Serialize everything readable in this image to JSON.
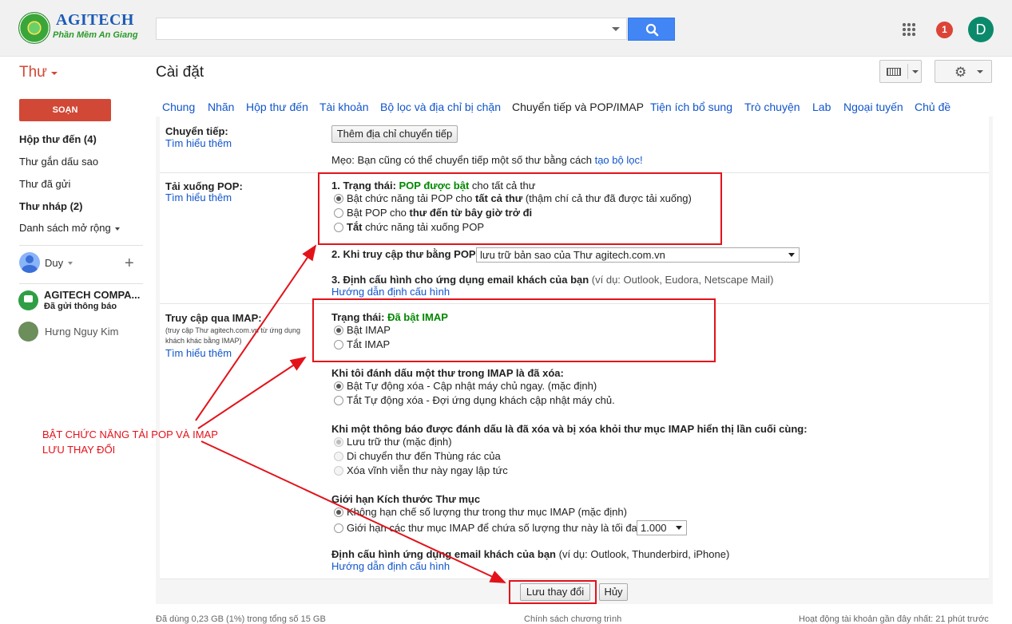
{
  "header": {
    "logo_title": "AGITECH",
    "logo_subtitle": "Phần Mềm An Giang",
    "search_value": "",
    "notification_count": "1",
    "account_initial": "D",
    "icons": [
      "search-icon",
      "apps-grid-icon",
      "gear-icon",
      "keyboard-icon"
    ]
  },
  "mail_label": "Thư",
  "page_title": "Cài đặt",
  "nav": {
    "compose": "SOẠN",
    "items": [
      {
        "label": "Hộp thư đến (4)",
        "bold": true
      },
      {
        "label": "Thư gắn dấu sao",
        "bold": false
      },
      {
        "label": "Thư đã gửi",
        "bold": false
      },
      {
        "label": "Thư nháp (2)",
        "bold": true
      },
      {
        "label": "Danh sách mở rộng",
        "bold": false
      }
    ],
    "user": "Duy",
    "hangouts": [
      {
        "name": "AGITECH COMPA...",
        "status": "Đã gửi thông báo"
      },
      {
        "name": "Hưng Nguy Kim"
      }
    ]
  },
  "tabs": [
    "Chung",
    "Nhãn",
    "Hộp thư đến",
    "Tài khoản",
    "Bộ lọc và địa chỉ bị chặn",
    "Chuyển tiếp và POP/IMAP",
    "Tiện ích bổ sung",
    "Trò chuyện",
    "Lab",
    "Ngoại tuyến",
    "Chủ đề"
  ],
  "active_tab": "Chuyển tiếp và POP/IMAP",
  "forwarding": {
    "label": "Chuyển tiếp:",
    "learn_more": "Tìm hiểu thêm",
    "add_button": "Thêm địa chỉ chuyển tiếp",
    "tip_prefix": "Mẹo: Bạn cũng có thể chuyển tiếp một số thư bằng cách ",
    "tip_link": "tạo bộ lọc!"
  },
  "pop": {
    "label": "Tải xuống POP:",
    "learn_more": "Tìm hiểu thêm",
    "status_prefix": "1. Trạng thái: ",
    "status_value": "POP được bật",
    "status_suffix": " cho tất cả thư",
    "opt1_a": "Bật chức năng tải POP cho ",
    "opt1_b": "tất cả thư",
    "opt1_c": " (thậm chí cả thư đã được tải xuống)",
    "opt2_a": "Bật POP cho ",
    "opt2_b": "thư đến từ bây giờ trở đi",
    "opt3_a": "Tắt",
    "opt3_b": " chức năng tải xuống POP",
    "access_label": "2. Khi truy cập thư bằng POP",
    "access_select": "lưu trữ bản sao của Thư agitech.com.vn",
    "config_label": "3. Định cấu hình cho ứng dụng email khách của bạn",
    "config_hint": " (ví dụ: Outlook, Eudora, Netscape Mail)",
    "config_link": "Hướng dẫn định cấu hình"
  },
  "imap": {
    "label": "Truy cập qua IMAP:",
    "note": "(truy cập Thư agitech.com.vn từ ứng dụng khách khác bằng IMAP)",
    "learn_more": "Tìm hiểu thêm",
    "status_prefix": "Trạng thái: ",
    "status_value": "Đã bật IMAP",
    "opt_on": "Bật IMAP",
    "opt_off": "Tắt IMAP",
    "delete_title": "Khi tôi đánh dấu một thư trong IMAP là đã xóa:",
    "delete_opt1": "Bật Tự động xóa - Cập nhật máy chủ ngay. (mặc định)",
    "delete_opt2": "Tắt Tự động xóa - Đợi ứng dụng khách cập nhật máy chủ.",
    "expunge_title": "Khi một thông báo được đánh dấu là đã xóa và bị xóa khỏi thư mục IMAP hiển thị lần cuối cùng:",
    "expunge_opt1": "Lưu trữ thư (mặc định)",
    "expunge_opt2": "Di chuyển thư đến Thùng rác của",
    "expunge_opt3": "Xóa vĩnh viễn thư này ngay lập tức",
    "folder_title": "Giới hạn Kích thước Thư mục",
    "folder_opt1": "Không hạn chế số lượng thư trong thư mục IMAP (mặc định)",
    "folder_opt2": "Giới hạn các thư mục IMAP để chứa số lượng thư này là tối đa",
    "folder_select": "1.000",
    "client_label": "Định cấu hình ứng dụng email khách của bạn",
    "client_hint": " (ví dụ: Outlook, Thunderbird, iPhone)",
    "client_link": "Hướng dẫn định cấu hình"
  },
  "actions": {
    "save": "Lưu thay đổi",
    "cancel": "Hủy"
  },
  "annotation": {
    "line1": "BẬT CHỨC NĂNG TẢI POP VÀ IMAP",
    "line2": "LƯU THAY ĐỔI",
    "color": "#e3121a"
  },
  "footer": {
    "storage": "Đã dùng 0,23 GB (1%) trong tổng số 15 GB",
    "policy": "Chính sách chương trình",
    "activity": "Hoạt động tài khoản gần đây nhất: 21 phút trước"
  }
}
